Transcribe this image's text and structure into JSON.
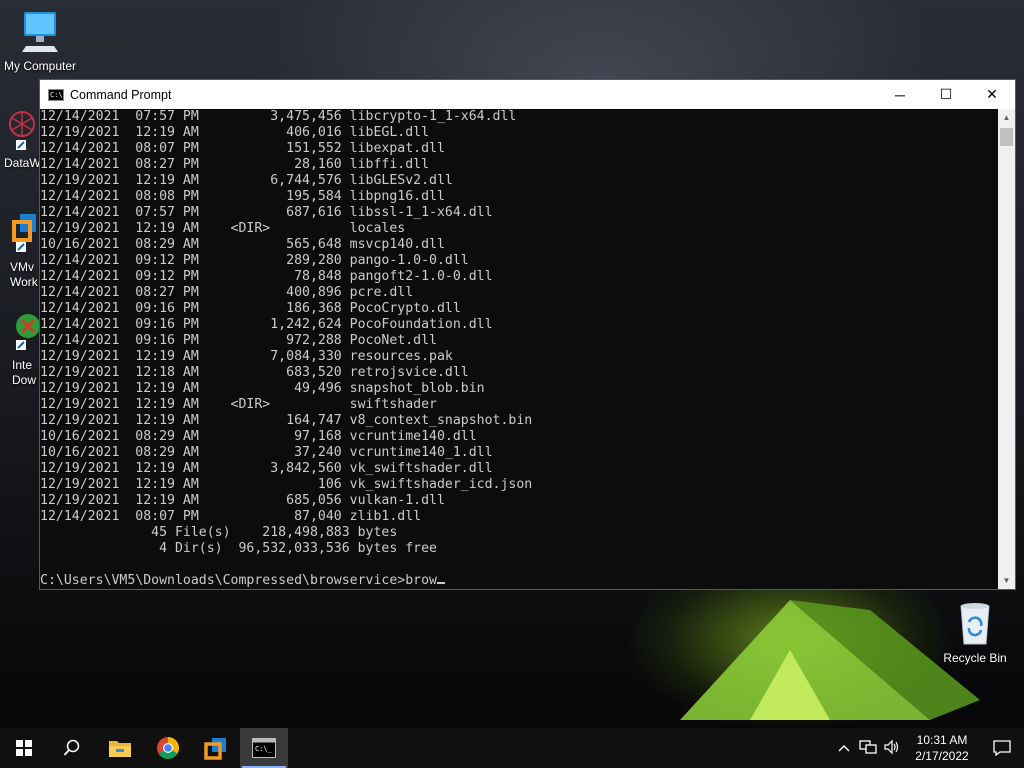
{
  "desktop": {
    "icons": [
      {
        "label": "My Computer"
      },
      {
        "label": "Recycle Bin"
      }
    ],
    "partial_labels": {
      "datawarehouse": "DataW",
      "vmware_line1": "VMv",
      "vmware_line2": "Work",
      "internet_line1": "Inte",
      "internet_line2": "Dow"
    }
  },
  "window": {
    "title": "Command Prompt",
    "minimize_glyph": "─",
    "maximize_glyph": "☐",
    "close_glyph": "✕",
    "console_lines": [
      "12/14/2021  07:57 PM         3,475,456 libcrypto-1_1-x64.dll",
      "12/19/2021  12:19 AM           406,016 libEGL.dll",
      "12/14/2021  08:07 PM           151,552 libexpat.dll",
      "12/14/2021  08:27 PM            28,160 libffi.dll",
      "12/19/2021  12:19 AM         6,744,576 libGLESv2.dll",
      "12/14/2021  08:08 PM           195,584 libpng16.dll",
      "12/14/2021  07:57 PM           687,616 libssl-1_1-x64.dll",
      "12/19/2021  12:19 AM    <DIR>          locales",
      "10/16/2021  08:29 AM           565,648 msvcp140.dll",
      "12/14/2021  09:12 PM           289,280 pango-1.0-0.dll",
      "12/14/2021  09:12 PM            78,848 pangoft2-1.0-0.dll",
      "12/14/2021  08:27 PM           400,896 pcre.dll",
      "12/14/2021  09:16 PM           186,368 PocoCrypto.dll",
      "12/14/2021  09:16 PM         1,242,624 PocoFoundation.dll",
      "12/14/2021  09:16 PM           972,288 PocoNet.dll",
      "12/19/2021  12:19 AM         7,084,330 resources.pak",
      "12/19/2021  12:18 AM           683,520 retrojsvice.dll",
      "12/19/2021  12:19 AM            49,496 snapshot_blob.bin",
      "12/19/2021  12:19 AM    <DIR>          swiftshader",
      "12/19/2021  12:19 AM           164,747 v8_context_snapshot.bin",
      "10/16/2021  08:29 AM            97,168 vcruntime140.dll",
      "10/16/2021  08:29 AM            37,240 vcruntime140_1.dll",
      "12/19/2021  12:19 AM         3,842,560 vk_swiftshader.dll",
      "12/19/2021  12:19 AM               106 vk_swiftshader_icd.json",
      "12/19/2021  12:19 AM           685,056 vulkan-1.dll",
      "12/14/2021  08:07 PM            87,040 zlib1.dll",
      "              45 File(s)    218,498,883 bytes",
      "               4 Dir(s)  96,532,033,536 bytes free",
      ""
    ],
    "prompt": "C:\\Users\\VM5\\Downloads\\Compressed\\browservice>",
    "typed_input": "brow"
  },
  "taskbar": {
    "items": [
      "start-icon",
      "search-icon",
      "file-explorer-icon",
      "chrome-icon",
      "vmware-icon",
      "command-prompt-icon"
    ],
    "clock_time": "10:31 AM",
    "clock_date": "2/17/2022"
  },
  "colors": {
    "console_bg": "#0c0c0c",
    "console_fg": "#cccccc",
    "taskbar_bg": "#101010"
  }
}
